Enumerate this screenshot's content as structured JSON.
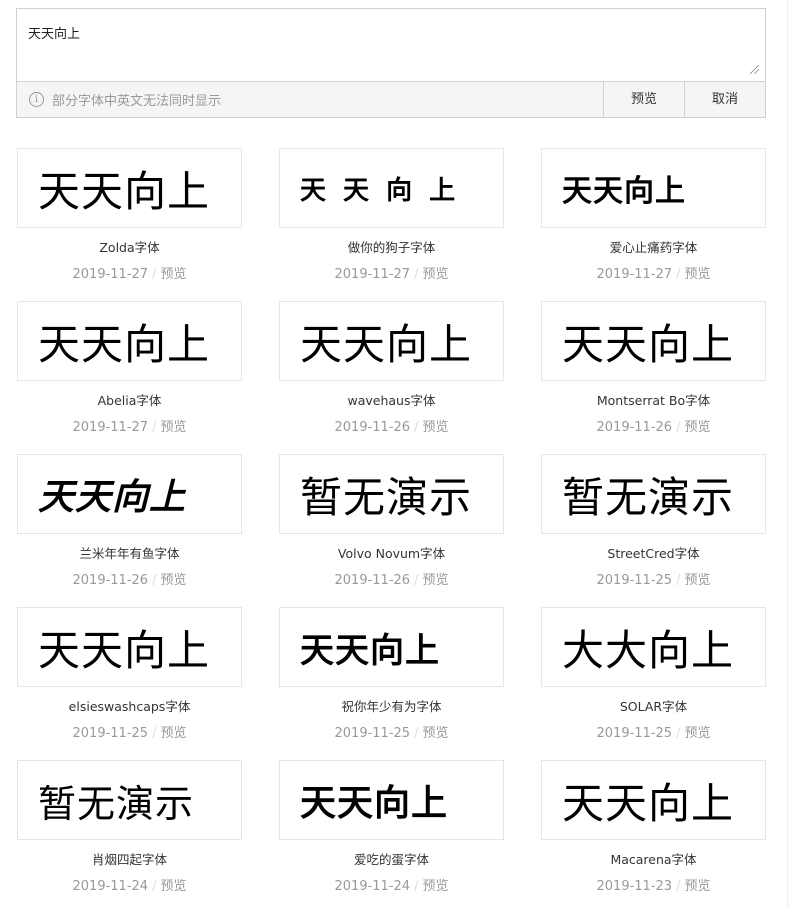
{
  "editor": {
    "value": "天天向上",
    "hint": "部分字体中英文无法同时显示",
    "preview_label": "预览",
    "cancel_label": "取消"
  },
  "fonts": [
    {
      "name": "Zolda字体",
      "date": "2019-11-27",
      "preview": "天天向上",
      "link": "预览"
    },
    {
      "name": "做你的狗子字体",
      "date": "2019-11-27",
      "preview": "天 天 向 上",
      "link": "预览"
    },
    {
      "name": "爱心止痛药字体",
      "date": "2019-11-27",
      "preview": "天天向上",
      "link": "预览"
    },
    {
      "name": "Abelia字体",
      "date": "2019-11-27",
      "preview": "天天向上",
      "link": "预览"
    },
    {
      "name": "wavehaus字体",
      "date": "2019-11-26",
      "preview": "天天向上",
      "link": "预览"
    },
    {
      "name": "Montserrat Bo字体",
      "date": "2019-11-26",
      "preview": "天天向上",
      "link": "预览"
    },
    {
      "name": "兰米年年有鱼字体",
      "date": "2019-11-26",
      "preview": "天天向上",
      "link": "预览"
    },
    {
      "name": "Volvo Novum字体",
      "date": "2019-11-26",
      "preview": "暂无演示",
      "link": "预览"
    },
    {
      "name": "StreetCred字体",
      "date": "2019-11-25",
      "preview": "暂无演示",
      "link": "预览"
    },
    {
      "name": "elsieswashcaps字体",
      "date": "2019-11-25",
      "preview": "天天向上",
      "link": "预览"
    },
    {
      "name": "祝你年少有为字体",
      "date": "2019-11-25",
      "preview": "天天向上",
      "link": "预览"
    },
    {
      "name": "SOLAR字体",
      "date": "2019-11-25",
      "preview": "大大向上",
      "link": "预览"
    },
    {
      "name": "肖烟四起字体",
      "date": "2019-11-24",
      "preview": "暂无演示",
      "link": "预览"
    },
    {
      "name": "爱吃的蛋字体",
      "date": "2019-11-24",
      "preview": "天天向上",
      "link": "预览"
    },
    {
      "name": "Macarena字体",
      "date": "2019-11-23",
      "preview": "天天向上",
      "link": "预览"
    }
  ]
}
